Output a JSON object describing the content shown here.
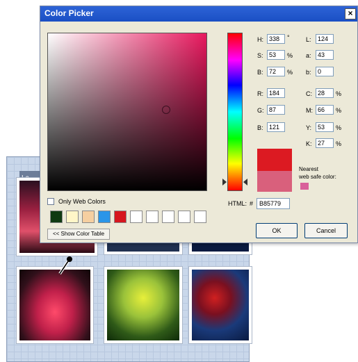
{
  "background_window": {
    "title": "La..."
  },
  "dialog": {
    "title": "Color Picker",
    "close_label": "×"
  },
  "fields": {
    "h": {
      "label": "H:",
      "value": "338",
      "unit": "°"
    },
    "s": {
      "label": "S:",
      "value": "53",
      "unit": "%"
    },
    "b": {
      "label": "B:",
      "value": "72",
      "unit": "%"
    },
    "r": {
      "label": "R:",
      "value": "184"
    },
    "g": {
      "label": "G:",
      "value": "87"
    },
    "bl": {
      "label": "B:",
      "value": "121"
    },
    "l": {
      "label": "L:",
      "value": "124"
    },
    "a": {
      "label": "a:",
      "value": "43"
    },
    "b2": {
      "label": "b:",
      "value": "0"
    },
    "c": {
      "label": "C:",
      "value": "28",
      "unit": "%"
    },
    "m": {
      "label": "M:",
      "value": "66",
      "unit": "%"
    },
    "y": {
      "label": "Y:",
      "value": "53",
      "unit": "%"
    },
    "k": {
      "label": "K:",
      "value": "27",
      "unit": "%"
    }
  },
  "html": {
    "label": "HTML:",
    "hash": "#",
    "value": "B85779"
  },
  "nearest": {
    "line1": "Nearest",
    "line2": "web safe color:",
    "color": "#d9609a"
  },
  "swatches": {
    "new_color": "#dc1a22",
    "old_color": "#d9607c"
  },
  "only_web_colors": {
    "label": "Only Web Colors",
    "checked": false
  },
  "palette": [
    "#0f3a12",
    "#fff6c8",
    "#f6cfa0",
    "#2a95e8",
    "#d6161e",
    "#ffffff",
    "#ffffff",
    "#ffffff",
    "#ffffff",
    "#ffffff"
  ],
  "buttons": {
    "show_table": "<< Show Color Table",
    "ok": "OK",
    "cancel": "Cancel"
  }
}
